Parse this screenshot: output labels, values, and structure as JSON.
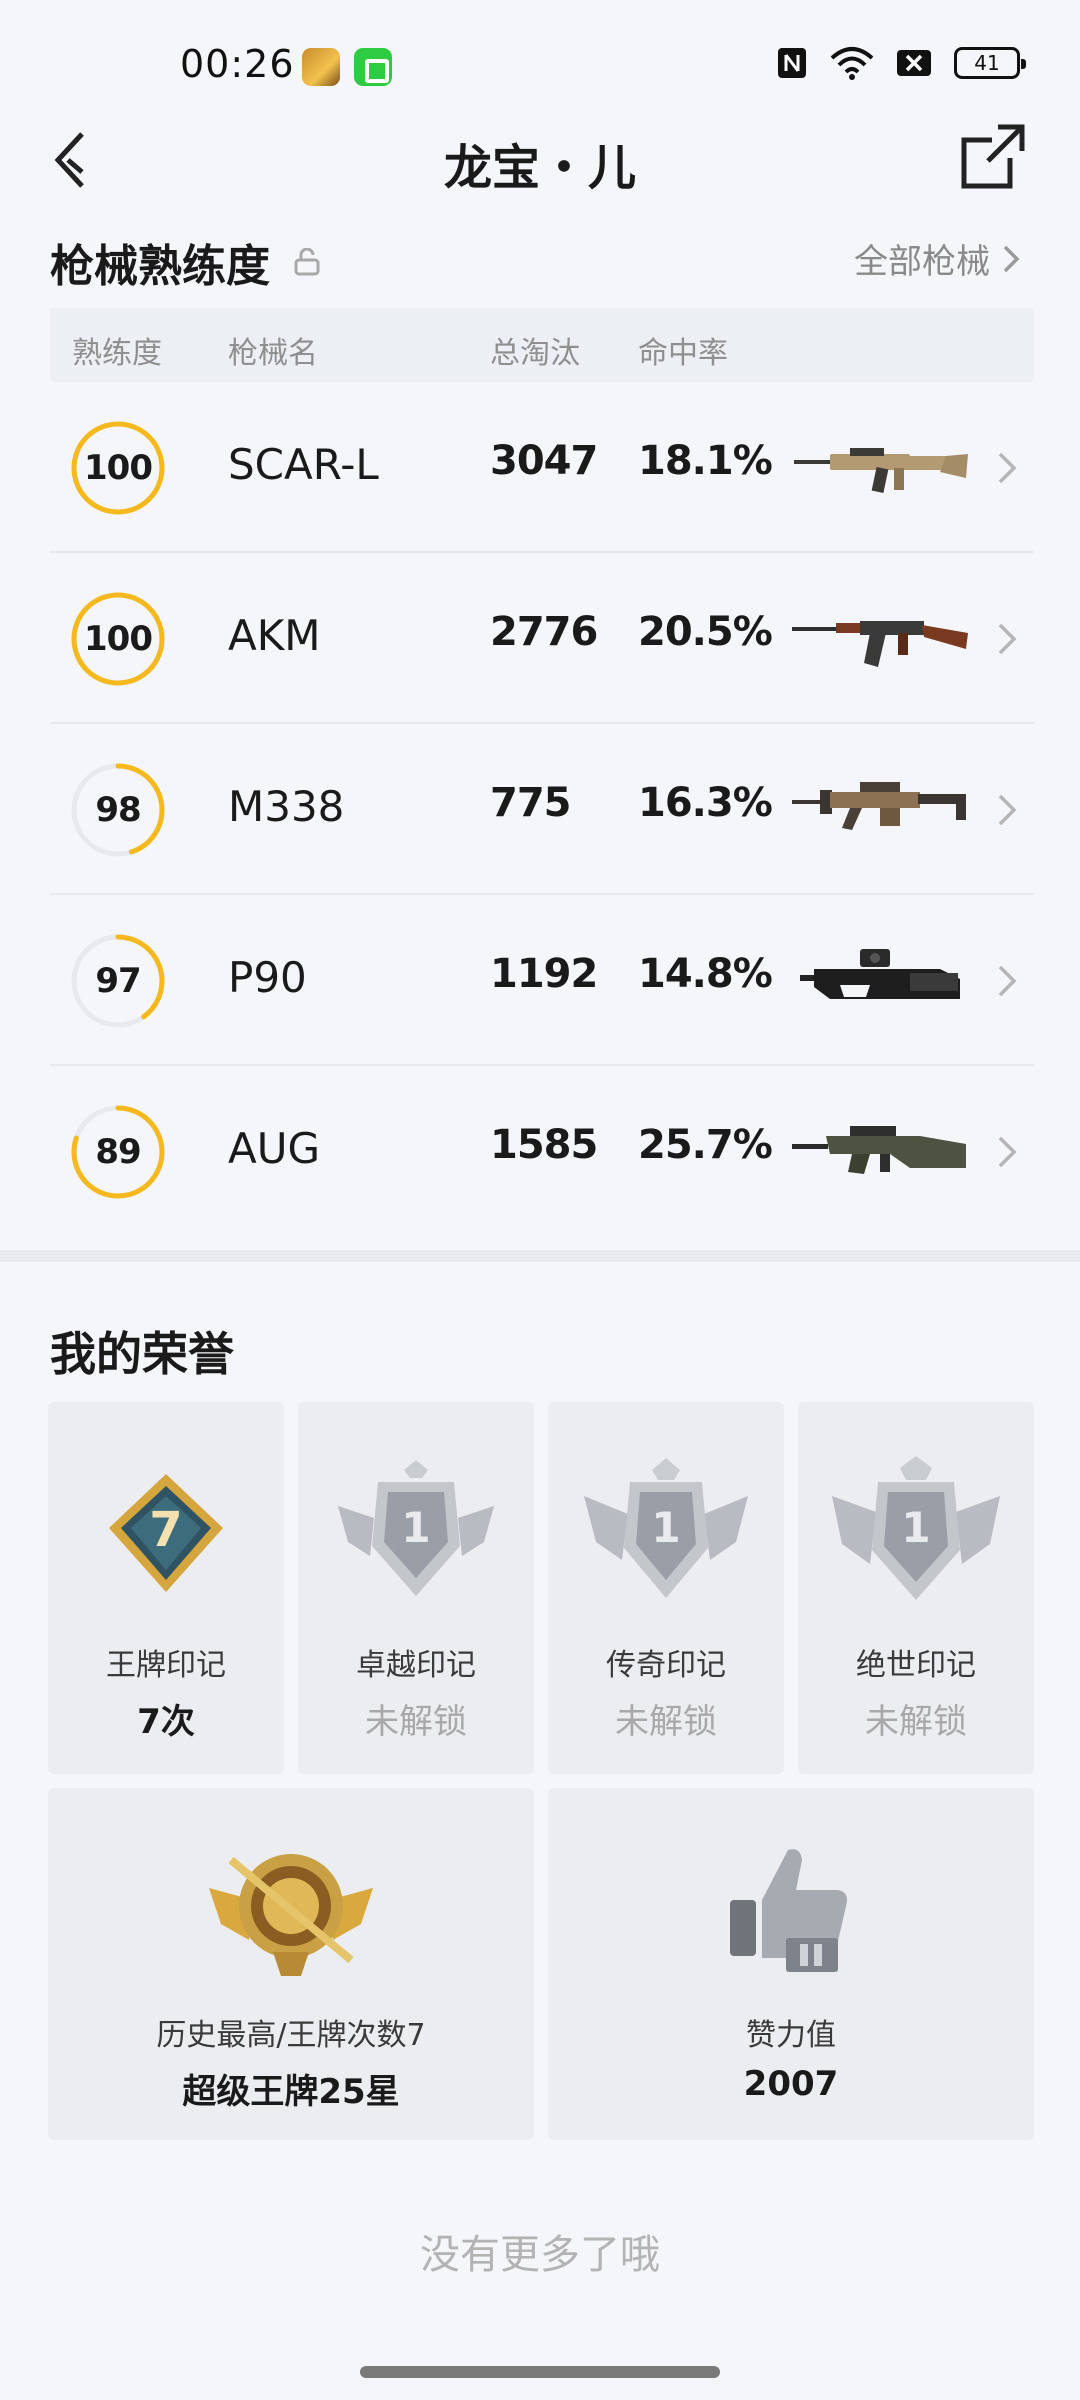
{
  "status_bar": {
    "time": "00:26",
    "battery": "41"
  },
  "header": {
    "title": "龙宝・儿"
  },
  "weapons": {
    "section_title": "枪械熟练度",
    "all_link": "全部枪械",
    "columns": [
      "熟练度",
      "枪械名",
      "总淘汰",
      "命中率"
    ],
    "rows": [
      {
        "proficiency": "100",
        "name": "SCAR-L",
        "kills": "3047",
        "hit_rate": "18.1%",
        "progress": 1.0
      },
      {
        "proficiency": "100",
        "name": "AKM",
        "kills": "2776",
        "hit_rate": "20.5%",
        "progress": 1.0
      },
      {
        "proficiency": "98",
        "name": "M338",
        "kills": "775",
        "hit_rate": "16.3%",
        "progress": 0.45
      },
      {
        "proficiency": "97",
        "name": "P90",
        "kills": "1192",
        "hit_rate": "14.8%",
        "progress": 0.4
      },
      {
        "proficiency": "89",
        "name": "AUG",
        "kills": "1585",
        "hit_rate": "25.7%",
        "progress": 0.8
      }
    ]
  },
  "honors": {
    "section_title": "我的荣誉",
    "cards": [
      {
        "label": "王牌印记",
        "value": "7次",
        "badge_number": "7"
      },
      {
        "label": "卓越印记",
        "value": "未解锁",
        "badge_number": "1"
      },
      {
        "label": "传奇印记",
        "value": "未解锁",
        "badge_number": "1"
      },
      {
        "label": "绝世印记",
        "value": "未解锁",
        "badge_number": "1"
      }
    ],
    "wide_cards": [
      {
        "label": "历史最高/王牌次数7",
        "value": "超级王牌25星"
      },
      {
        "label": "赞力值",
        "value": "2007"
      }
    ]
  },
  "footer": {
    "no_more": "没有更多了哦"
  },
  "colors": {
    "ring_gold": "#f5b91e",
    "ring_track": "#e8e9ec",
    "background": "#f4f6f9"
  }
}
